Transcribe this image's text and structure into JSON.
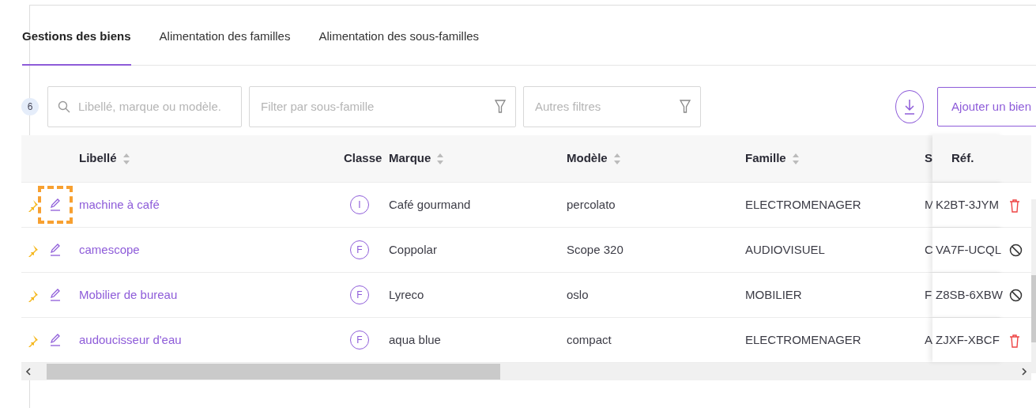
{
  "tabs": [
    {
      "label": "Gestions des biens",
      "selected": true
    },
    {
      "label": "Alimentation des familles",
      "selected": false
    },
    {
      "label": "Alimentation des sous-familles",
      "selected": false
    }
  ],
  "toolbar": {
    "count": "6",
    "search": {
      "placeholder": "Libellé, marque ou modèle."
    },
    "subfamily_filter": {
      "placeholder": "Filter par sous-famille"
    },
    "other_filters": {
      "placeholder": "Autres filtres"
    },
    "add_button": "Ajouter un bien"
  },
  "table": {
    "columns": [
      {
        "label": "Libellé",
        "sortable": true
      },
      {
        "label": "Classe"
      },
      {
        "label": "Marque",
        "sortable": true
      },
      {
        "label": "Modèle",
        "sortable": true
      },
      {
        "label": "Famille",
        "sortable": true
      },
      {
        "label": "S"
      },
      {
        "label": "Réf.",
        "sortable": false
      }
    ],
    "rows": [
      {
        "highlighted": true,
        "libelle": "machine à café",
        "classe": "I",
        "marque": "Café gourmand",
        "modele": "percolato",
        "famille": "ELECTROMENAGER",
        "column_6": "M",
        "ref": "K2BT-3JYM",
        "kind": "delete"
      },
      {
        "highlighted": false,
        "libelle": "camescope",
        "classe": "F",
        "marque": "Coppolar",
        "modele": "Scope 320",
        "famille": "AUDIOVISUEL",
        "column_6": "C",
        "ref": "VA7F-UCQL",
        "kind": "block"
      },
      {
        "highlighted": false,
        "libelle": "Mobilier de bureau",
        "classe": "F",
        "marque": "Lyreco",
        "modele": "oslo",
        "famille": "MOBILIER",
        "column_6": "F",
        "ref": "Z8SB-6XBW",
        "kind": "block"
      },
      {
        "highlighted": false,
        "libelle": "audoucisseur d'eau",
        "classe": "F",
        "marque": "aqua blue",
        "modele": "compact",
        "famille": "ELECTROMENAGER",
        "column_6": "A",
        "ref": "ZJXF-XBCF",
        "kind": "delete"
      }
    ]
  }
}
